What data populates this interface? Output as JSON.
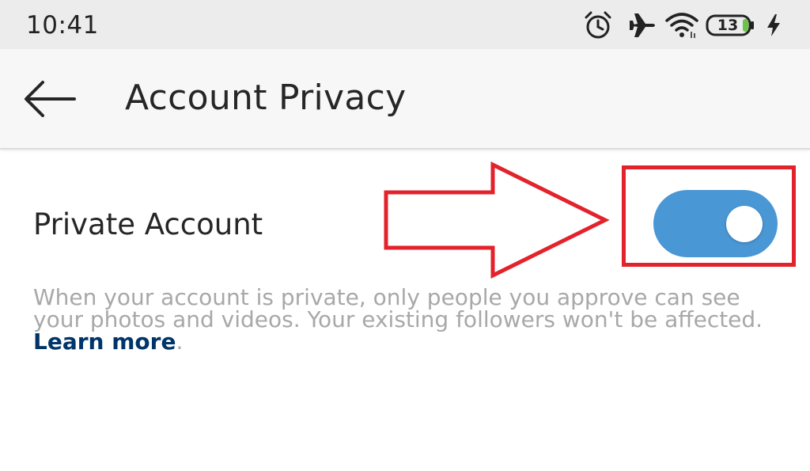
{
  "status_bar": {
    "time": "10:41",
    "battery_level": "13",
    "icons": [
      "alarm-icon",
      "airplane-icon",
      "wifi-icon",
      "battery-icon",
      "charging-icon"
    ]
  },
  "header": {
    "title": "Account Privacy",
    "back_icon": "back-arrow-icon"
  },
  "setting": {
    "label": "Private Account",
    "toggle_on": true,
    "toggle_color": "#4a97d6"
  },
  "description": {
    "text": "When your account is private, only people you approve can see your photos and videos. Your existing followers won't be affected. ",
    "link_text": "Learn more",
    "link_color": "#003569",
    "suffix": "."
  },
  "annotation": {
    "highlight_color": "#e3232c"
  }
}
